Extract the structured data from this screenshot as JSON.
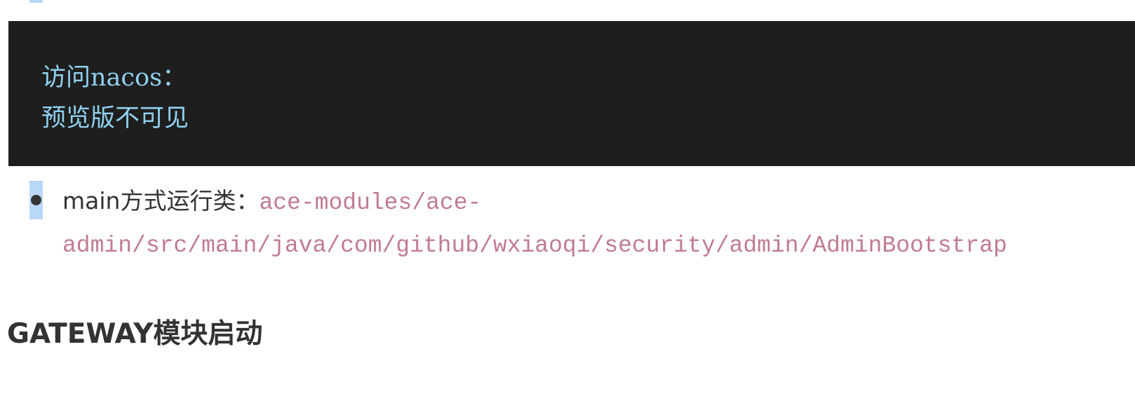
{
  "code_block": {
    "lines": [
      {
        "cn": "访问",
        "en": "nacos",
        "suffix": "："
      },
      {
        "cn": "预览版不可见"
      }
    ]
  },
  "bullet": {
    "label": "main方式运行类：",
    "path_line1": "ace-modules/ace-",
    "path_line2": "admin/src/main/java/com/github/wxiaoqi/security/admin/AdminBootstrap"
  },
  "heading": {
    "title": "GATEWAY模块启动"
  },
  "colors": {
    "code_bg": "#1e1e1e",
    "code_text": "#8fd1ef",
    "inline_code": "#c07b92",
    "highlight": "#b9d7f7",
    "body_text": "#333333"
  }
}
